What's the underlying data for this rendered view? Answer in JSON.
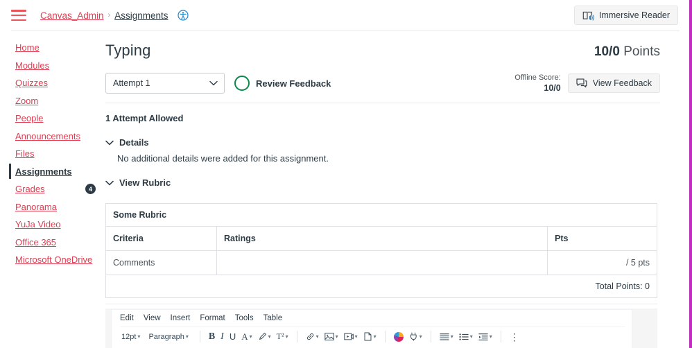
{
  "topbar": {
    "menu_icon": "hamburger-icon",
    "breadcrumb": {
      "root": "Canvas_Admin",
      "separator": "›",
      "current": "Assignments",
      "a11y_icon": "accessibility-icon"
    },
    "immersive_reader_label": "Immersive Reader",
    "immersive_reader_icon": "immersive-reader-icon"
  },
  "sidebar": {
    "items": [
      {
        "label": "Home",
        "active": false,
        "badge": ""
      },
      {
        "label": "Modules",
        "active": false,
        "badge": ""
      },
      {
        "label": "Quizzes",
        "active": false,
        "badge": ""
      },
      {
        "label": "Zoom",
        "active": false,
        "badge": ""
      },
      {
        "label": "People",
        "active": false,
        "badge": ""
      },
      {
        "label": "Announcements",
        "active": false,
        "badge": ""
      },
      {
        "label": "Files",
        "active": false,
        "badge": ""
      },
      {
        "label": "Assignments",
        "active": true,
        "badge": ""
      },
      {
        "label": "Grades",
        "active": false,
        "badge": "4"
      },
      {
        "label": "Panorama",
        "active": false,
        "badge": ""
      },
      {
        "label": "YuJa Video",
        "active": false,
        "badge": ""
      },
      {
        "label": "Office 365",
        "active": false,
        "badge": ""
      },
      {
        "label": "Microsoft OneDrive",
        "active": false,
        "badge": ""
      }
    ]
  },
  "assignment": {
    "title": "Typing",
    "points_value": "10/0",
    "points_label": "Points",
    "attempt_select_value": "Attempt 1",
    "attempt_options": [
      "Attempt 1"
    ],
    "review_feedback_label": "Review Feedback",
    "offline_score_label": "Offline Score:",
    "offline_score_value": "10/0",
    "view_feedback_label": "View Feedback",
    "attempts_allowed": "1 Attempt Allowed",
    "details_heading": "Details",
    "details_body": "No additional details were added for this assignment.",
    "view_rubric_heading": "View Rubric"
  },
  "rubric": {
    "title": "Some Rubric",
    "columns": [
      "Criteria",
      "Ratings",
      "Pts"
    ],
    "rows": [
      {
        "criteria": "Comments",
        "ratings": "",
        "pts": "/ 5 pts"
      }
    ],
    "total": "Total Points: 0"
  },
  "editor": {
    "menus": [
      "Edit",
      "View",
      "Insert",
      "Format",
      "Tools",
      "Table"
    ],
    "font_size": "12pt",
    "block_format": "Paragraph",
    "tools": [
      {
        "name": "bold-icon",
        "glyph": "B"
      },
      {
        "name": "italic-icon",
        "glyph": "I"
      },
      {
        "name": "underline-icon",
        "glyph": "U"
      },
      {
        "name": "text-color-icon",
        "glyph": "A"
      },
      {
        "name": "highlight-icon",
        "glyph": "pen"
      },
      {
        "name": "superscript-icon",
        "glyph": "T²"
      },
      {
        "name": "link-icon",
        "glyph": "link"
      },
      {
        "name": "image-icon",
        "glyph": "image"
      },
      {
        "name": "media-icon",
        "glyph": "media"
      },
      {
        "name": "document-icon",
        "glyph": "doc"
      },
      {
        "name": "canvas-studio-icon",
        "glyph": "studio"
      },
      {
        "name": "apps-plugin-icon",
        "glyph": "plug"
      },
      {
        "name": "align-icon",
        "glyph": "align"
      },
      {
        "name": "bullet-list-icon",
        "glyph": "list"
      },
      {
        "name": "indent-icon",
        "glyph": "indent"
      },
      {
        "name": "more-options-icon",
        "glyph": "kebab"
      }
    ]
  },
  "colors": {
    "link_red": "#E03E52",
    "text_dark": "#2D3B45",
    "green_ring": "#0B874B",
    "accent_edge": "#C32BBE"
  }
}
